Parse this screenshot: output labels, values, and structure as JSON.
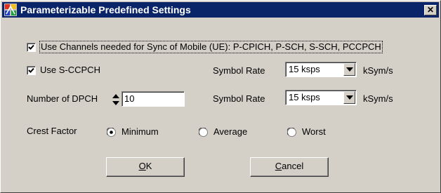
{
  "window": {
    "title": "Parameterizable Predefined Settings",
    "close_glyph": "✕"
  },
  "icons": {
    "app": "app-icon",
    "close": "close-icon",
    "check": "checkmark-icon",
    "dropdown": "triangle-down-icon",
    "spinner": "up-down-arrows-icon"
  },
  "colors": {
    "titlebar": "#0a246a",
    "face": "#d4d0c8"
  },
  "sync_channels": {
    "checked": true,
    "label": "Use Channels needed for Sync of Mobile (UE): P-CPICH, P-SCH, S-SCH, PCCPCH"
  },
  "s_ccpch": {
    "checked": true,
    "label": "Use S-CCPCH",
    "symbol_rate_label": "Symbol Rate",
    "symbol_rate_value": "15 ksps",
    "unit": "kSym/s"
  },
  "dpch": {
    "label": "Number of DPCH",
    "value": "10",
    "symbol_rate_label": "Symbol Rate",
    "symbol_rate_value": "15 ksps",
    "unit": "kSym/s"
  },
  "crest_factor": {
    "label": "Crest Factor",
    "selected": "Minimum",
    "options": [
      "Minimum",
      "Average",
      "Worst"
    ]
  },
  "buttons": {
    "ok_underline": "O",
    "ok_rest": "K",
    "cancel_underline": "C",
    "cancel_rest": "ancel"
  }
}
